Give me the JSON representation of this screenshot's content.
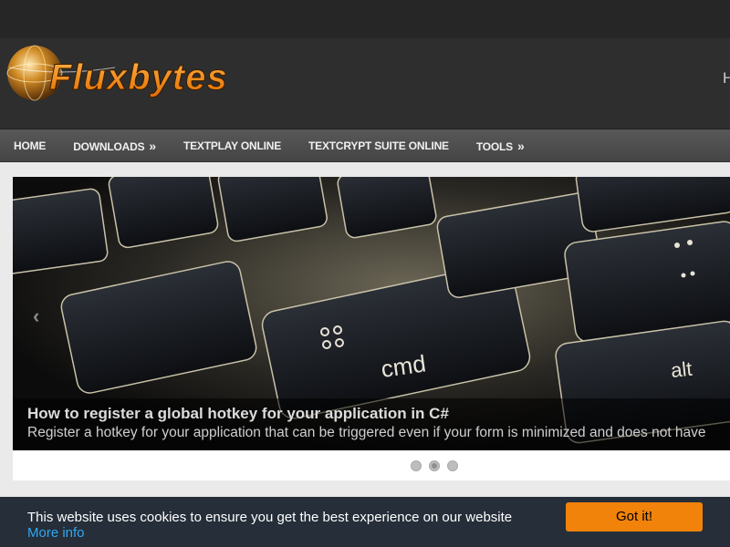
{
  "header": {
    "logo_text": "Fluxbytes",
    "right_text": "H"
  },
  "nav": {
    "items": [
      {
        "label": "HOME",
        "has_submenu": false
      },
      {
        "label": "DOWNLOADS",
        "has_submenu": true
      },
      {
        "label": "TEXTPLAY ONLINE",
        "has_submenu": false
      },
      {
        "label": "TEXTCRYPT SUITE ONLINE",
        "has_submenu": false
      },
      {
        "label": "TOOLS",
        "has_submenu": true
      }
    ],
    "submenu_arrow": "»"
  },
  "slider": {
    "prev_icon": "chevron-left-icon",
    "prev_glyph": "‹",
    "caption_title": "How to register a global hotkey for your application in C#",
    "caption_text": "Register a hotkey for your application that can be triggered even if your form is minimized and does not have",
    "slide_count": 3,
    "active_slide": 2,
    "key_cmd": "cmd",
    "key_alt": "alt"
  },
  "cookie": {
    "message": "This website uses cookies to ensure you get the best experience on our website",
    "link_text": "More info",
    "button_label": "Got it!"
  },
  "colors": {
    "accent_orange": "#f1830b",
    "cookie_bg": "#252e39",
    "link_blue": "#31a8f0"
  }
}
